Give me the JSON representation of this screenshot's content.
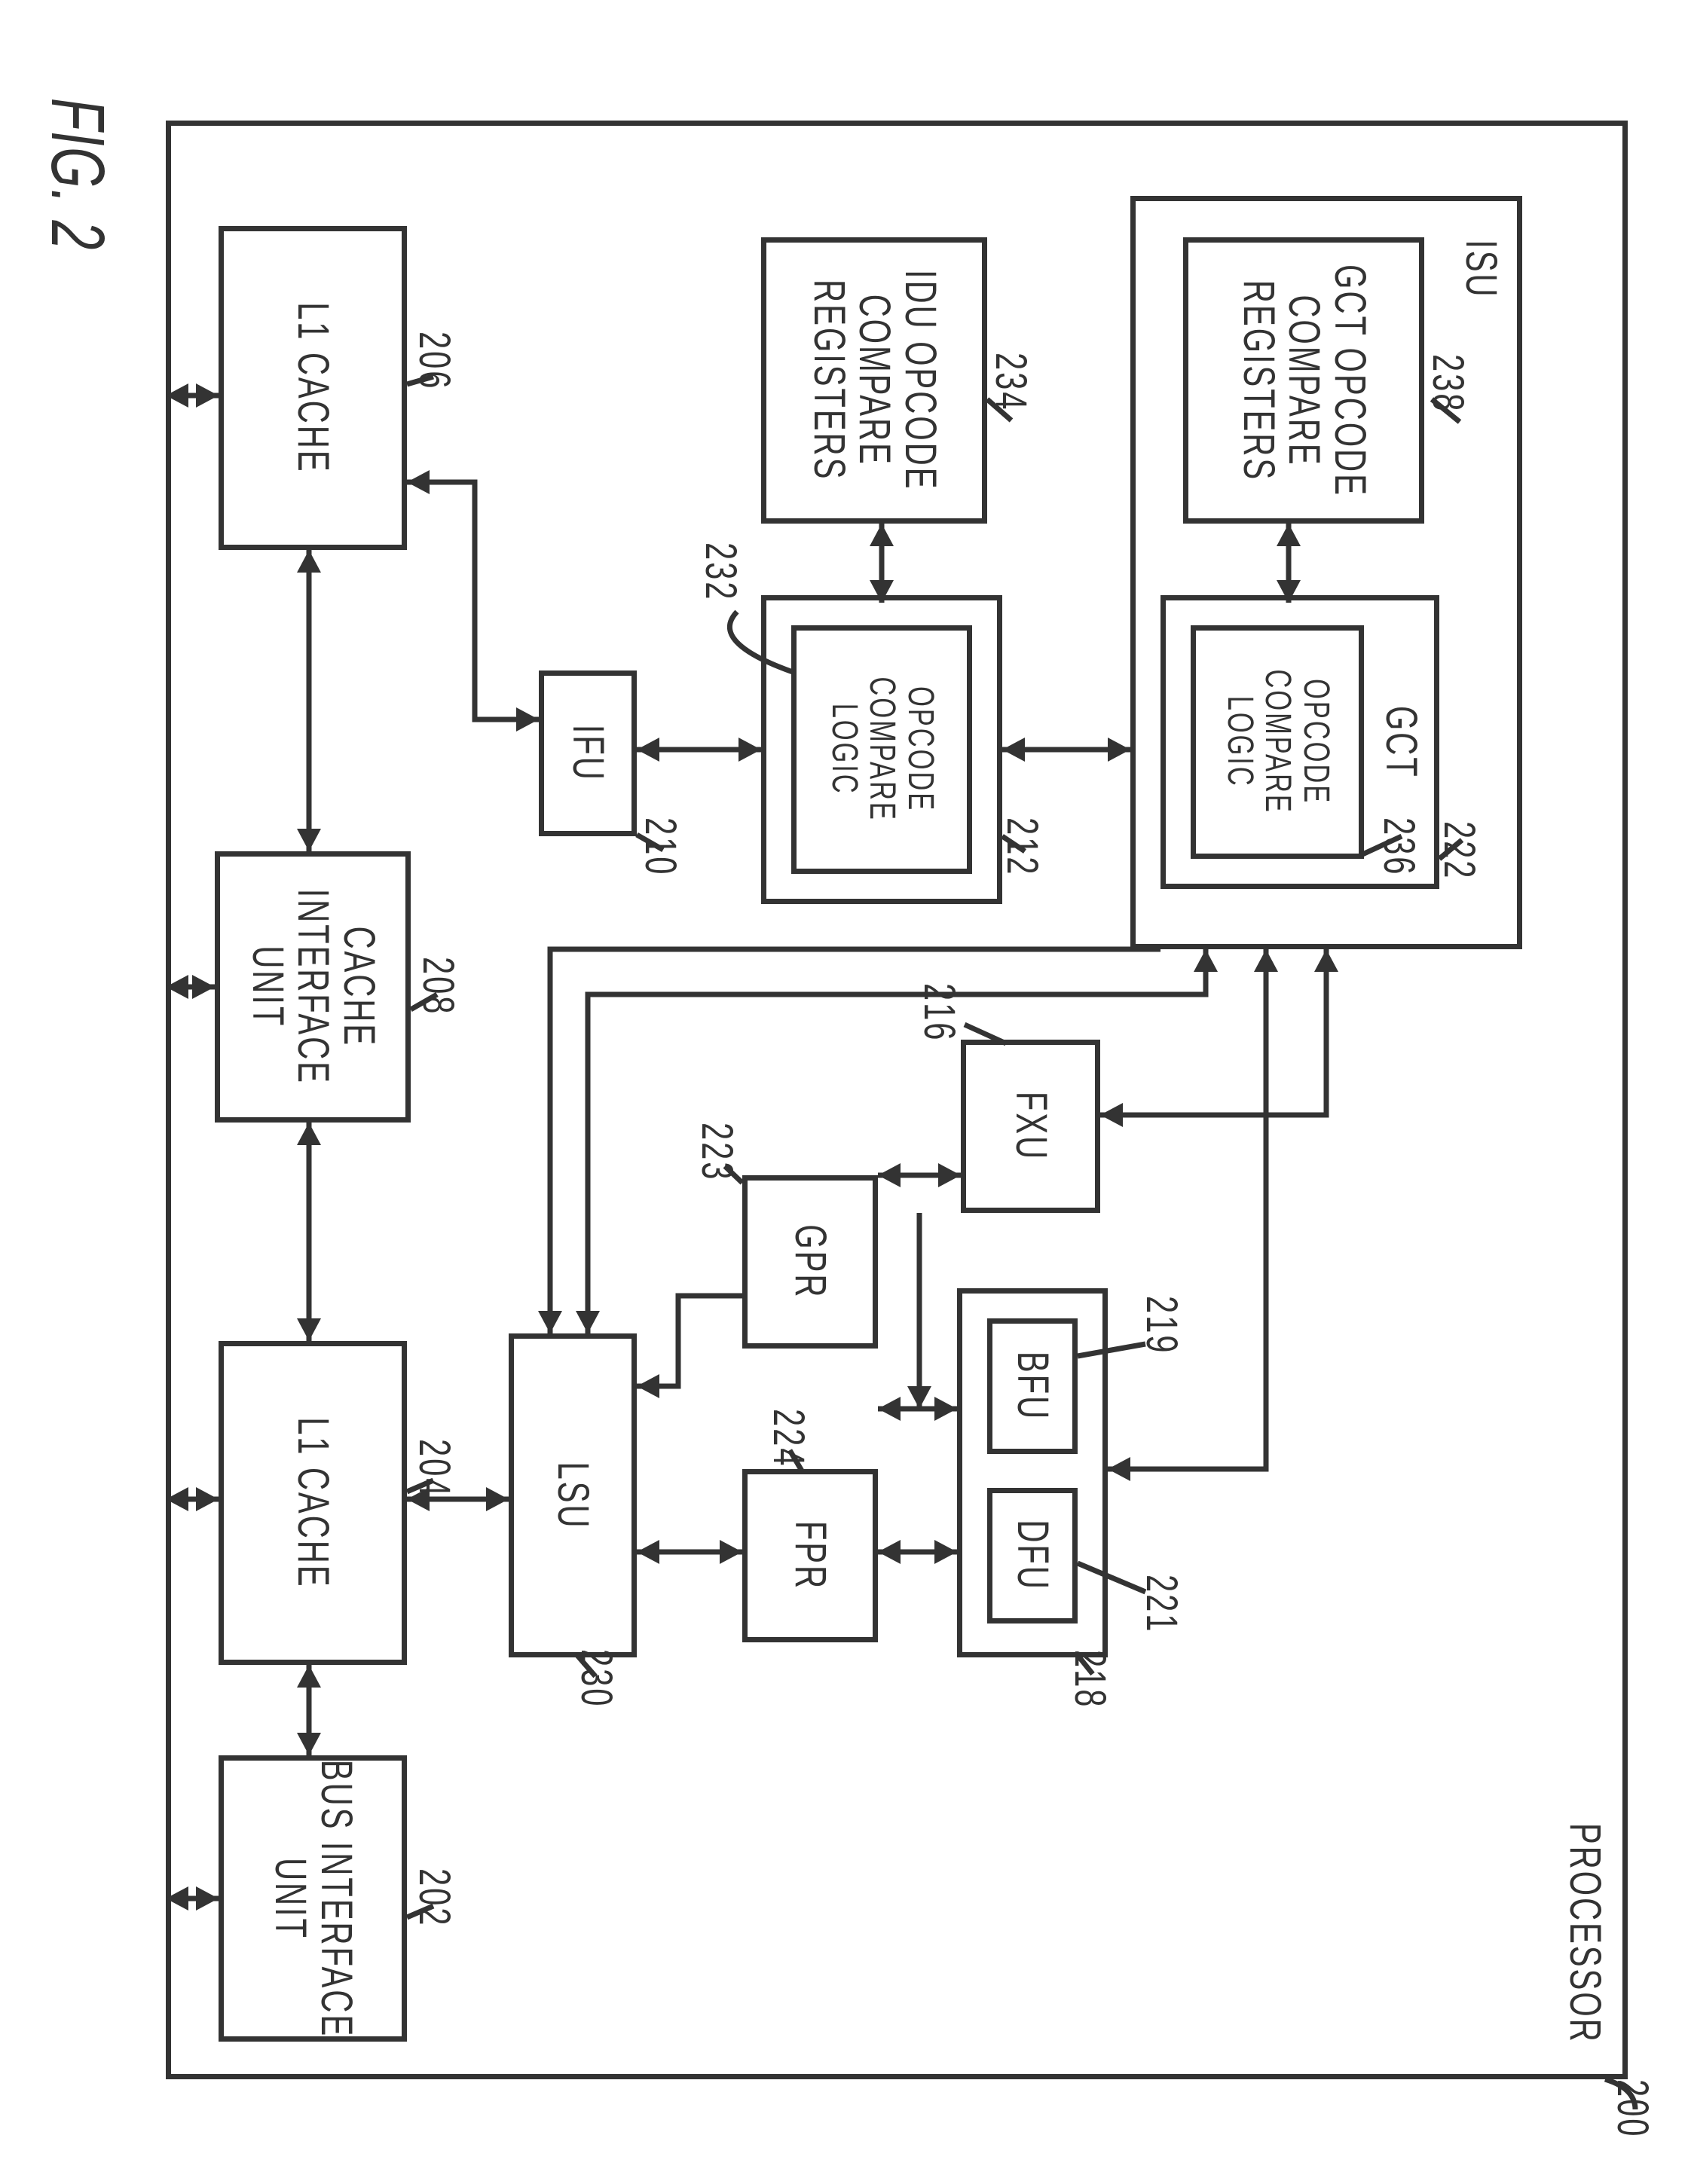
{
  "figure_caption": "FIG. 2",
  "processor": {
    "title": "PROCESSOR",
    "ref": "200"
  },
  "isu": {
    "title": "ISU"
  },
  "blocks": {
    "gct_opcode_compare_registers": {
      "label": "GCT OPCODE\nCOMPARE\nREGISTERS",
      "ref": "238"
    },
    "gct": {
      "label": "GCT",
      "ref": "222"
    },
    "gct_opcode_compare_logic": {
      "label": "OPCODE\nCOMPARE\nLOGIC",
      "ref": "236"
    },
    "idu_opcode_compare_registers": {
      "label": "IDU OPCODE\nCOMPARE\nREGISTERS",
      "ref": "234"
    },
    "idu": {
      "ref": "212"
    },
    "idu_opcode_compare_logic": {
      "label": "OPCODE\nCOMPARE\nLOGIC",
      "ref": "232"
    },
    "ifu": {
      "label": "IFU",
      "ref": "210"
    },
    "fxu": {
      "label": "FXU",
      "ref": "216"
    },
    "fpu_container": {
      "ref": "218"
    },
    "bfu": {
      "label": "BFU",
      "ref": "219"
    },
    "dfu": {
      "label": "DFU",
      "ref": "221"
    },
    "gpr": {
      "label": "GPR",
      "ref": "223"
    },
    "fpr": {
      "label": "FPR",
      "ref": "224"
    },
    "lsu": {
      "label": "LSU",
      "ref": "230"
    },
    "l1i": {
      "label": "L1 CACHE",
      "ref": "206"
    },
    "ciu": {
      "label": "CACHE\nINTERFACE\nUNIT",
      "ref": "208"
    },
    "l1d": {
      "label": "L1 CACHE",
      "ref": "204"
    },
    "biu": {
      "label": "BUS INTERFACE\nUNIT",
      "ref": "202"
    }
  }
}
